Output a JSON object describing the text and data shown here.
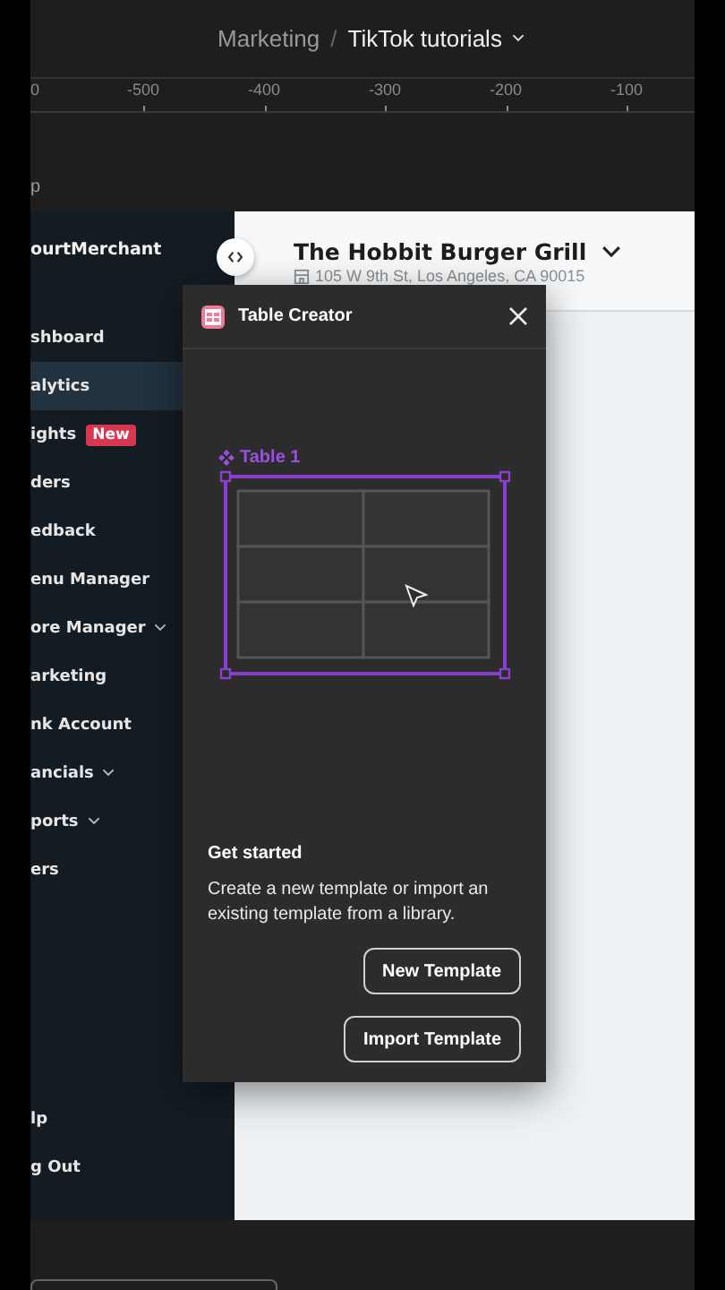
{
  "breadcrumb": {
    "parent": "Marketing",
    "separator": "/",
    "current": "TikTok tutorials"
  },
  "ruler": {
    "ticks": [
      "0",
      "-500",
      "-400",
      "-300",
      "-200",
      "-100"
    ]
  },
  "frame_label": "p",
  "sidebar": {
    "brand": "ourtMerchant",
    "items": [
      {
        "label": "shboard",
        "selected": false,
        "expandable": false
      },
      {
        "label": "alytics",
        "selected": true,
        "expandable": false
      },
      {
        "label": "ights",
        "selected": false,
        "expandable": false,
        "badge": "New"
      },
      {
        "label": "ders",
        "selected": false,
        "expandable": false
      },
      {
        "label": "edback",
        "selected": false,
        "expandable": false
      },
      {
        "label": "enu Manager",
        "selected": false,
        "expandable": false
      },
      {
        "label": "ore Manager",
        "selected": false,
        "expandable": true
      },
      {
        "label": "arketing",
        "selected": false,
        "expandable": false
      },
      {
        "label": "nk Account",
        "selected": false,
        "expandable": false
      },
      {
        "label": "ancials",
        "selected": false,
        "expandable": true
      },
      {
        "label": "ports",
        "selected": false,
        "expandable": true
      },
      {
        "label": "ers",
        "selected": false,
        "expandable": false
      }
    ],
    "footer_items": [
      {
        "label": "lp",
        "selected": false
      },
      {
        "label": "g Out",
        "selected": false
      }
    ]
  },
  "venue": {
    "name": "The Hobbit Burger Grill",
    "address": "105 W 9th St, Los Angeles, CA 90015"
  },
  "plugin": {
    "title": "Table Creator",
    "layer_name": "Table 1",
    "heading": "Get started",
    "description": "Create a new template or import an existing template from a library.",
    "buttons": [
      {
        "label": "New Template"
      },
      {
        "label": "Import Template"
      }
    ]
  }
}
